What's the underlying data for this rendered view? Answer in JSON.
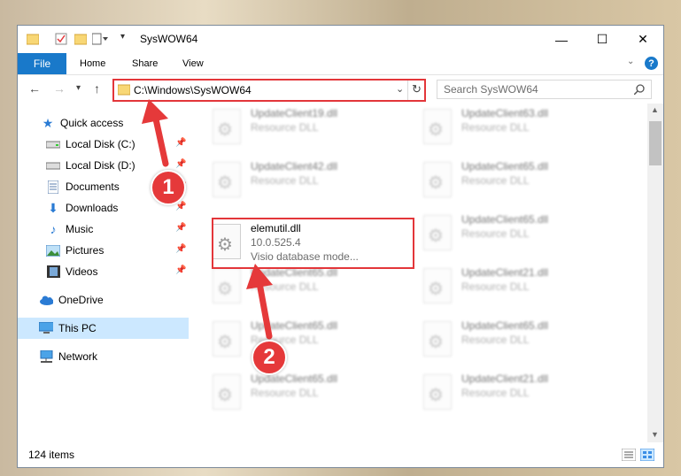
{
  "window": {
    "title": "SysWOW64",
    "controls": {
      "minimize": "—",
      "maximize": "☐",
      "close": "✕"
    }
  },
  "ribbon": {
    "tabs": [
      {
        "label": "File"
      },
      {
        "label": "Home"
      },
      {
        "label": "Share"
      },
      {
        "label": "View"
      }
    ],
    "help": "?"
  },
  "address_bar": {
    "path": "C:\\Windows\\SysWOW64",
    "search_placeholder": "Search SysWOW64"
  },
  "nav_pane": {
    "items": [
      {
        "label": "Quick access",
        "icon": "star-icon"
      },
      {
        "label": "Local Disk (C:)",
        "icon": "drive-icon",
        "pinned": true
      },
      {
        "label": "Local Disk (D:)",
        "icon": "drive-icon",
        "pinned": true
      },
      {
        "label": "Documents",
        "icon": "documents-icon",
        "pinned": true
      },
      {
        "label": "Downloads",
        "icon": "download-icon",
        "pinned": true
      },
      {
        "label": "Music",
        "icon": "music-icon",
        "pinned": true
      },
      {
        "label": "Pictures",
        "icon": "pictures-icon",
        "pinned": true
      },
      {
        "label": "Videos",
        "icon": "videos-icon",
        "pinned": true
      },
      {
        "label": "OneDrive",
        "icon": "cloud-icon"
      },
      {
        "label": "This PC",
        "icon": "computer-icon",
        "selected": true
      },
      {
        "label": "Network",
        "icon": "network-icon"
      }
    ]
  },
  "files": [
    {
      "name": "UpdateClient19.dll",
      "type": "Resource DLL"
    },
    {
      "name": "UpdateClient63.dll",
      "type": "Resource DLL"
    },
    {
      "name": "UpdateClient42.dll",
      "type": "Resource DLL"
    },
    {
      "name": "UpdateClient65.dll",
      "type": "Resource DLL"
    },
    {
      "name": "elemutil.dll",
      "version": "10.0.525.4",
      "type": "Visio database mode..."
    },
    {
      "name": "UpdateClient65.dll",
      "type": "Resource DLL"
    },
    {
      "name": "UpdateClient65.dll",
      "type": "Resource DLL"
    },
    {
      "name": "UpdateClient21.dll",
      "type": "Resource DLL"
    },
    {
      "name": "UpdateClient65.dll",
      "type": "Resource DLL"
    },
    {
      "name": "UpdateClient65.dll",
      "type": "Resource DLL"
    },
    {
      "name": "UpdateClient65.dll",
      "type": "Resource DLL"
    },
    {
      "name": "UpdateClient21.dll",
      "type": "Resource DLL"
    }
  ],
  "status": {
    "item_count": "124 items"
  },
  "annotations": {
    "step1": "1",
    "step2": "2"
  },
  "colors": {
    "accent": "#1979ca",
    "annotation_red": "#e5393a",
    "selected_bg": "#cce8ff"
  }
}
